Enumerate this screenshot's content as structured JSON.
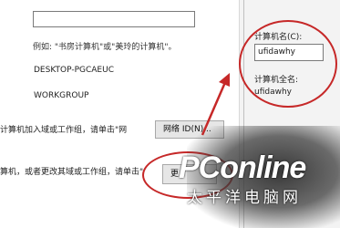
{
  "left": {
    "hint": "例如: \"书房计算机\"或\"美玲的计算机\"。",
    "computer_name": "DESKTOP-PGCAEUC",
    "workgroup": "WORKGROUP",
    "join_text": "计算机加入域或工作组，请单击\"网",
    "rename_text": "算机，或者更改其域或工作组，请单击\"",
    "network_id_button": "网络 ID(N)...",
    "change_button": "更"
  },
  "right": {
    "name_label": "计算机名(C):",
    "name_value": "ufidawhy",
    "full_name_label": "计算机全名:",
    "full_name_value": "ufidawhy"
  },
  "watermark": {
    "brand": "PConline",
    "subtitle": "太平洋电脑网"
  },
  "colors": {
    "annotation": "#c62828"
  }
}
